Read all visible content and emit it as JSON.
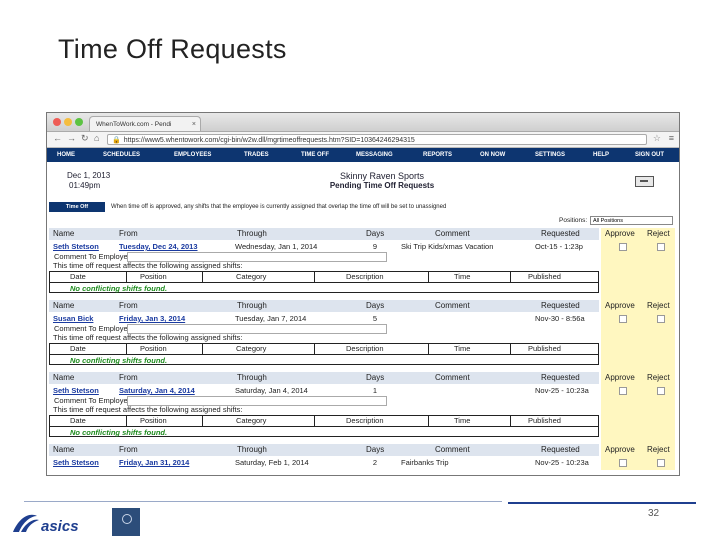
{
  "slide": {
    "title": "Time Off Requests",
    "page_number": "32"
  },
  "browser": {
    "tab_title": "WhenToWork.com - Pendi",
    "url": "https://www5.whentowork.com/cgi-bin/w2w.dll/mgrtimeoffrequests.htm?SID=10364246294315"
  },
  "nav": [
    "HOME",
    "SCHEDULES",
    "EMPLOYEES",
    "TRADES",
    "TIME OFF",
    "MESSAGING",
    "REPORTS",
    "ON NOW",
    "SETTINGS",
    "HELP",
    "SIGN OUT"
  ],
  "header": {
    "date": "Dec 1, 2013",
    "time": "01:49pm",
    "company": "Skinny Raven Sports",
    "page_heading": "Pending Time Off Requests"
  },
  "section_label": "Time Off",
  "notice": "When time off is approved, any shifts that the employee is currently assigned that overlap the time off will be set to unassigned",
  "positions": {
    "label": "Positions:",
    "selected": "All Positions"
  },
  "columns": [
    "Name",
    "From",
    "Through",
    "Days",
    "Comment",
    "Requested",
    "Approve",
    "Reject"
  ],
  "labels": {
    "comment_to_employee": "Comment To Employee:",
    "affects": "This time off request affects the following assigned shifts:",
    "no_conflicts": "No conflicting shifts found."
  },
  "shift_columns": [
    "Date",
    "Position",
    "Category",
    "Description",
    "Time",
    "Published"
  ],
  "requests": [
    {
      "name": "Seth Stetson",
      "from": "Tuesday, Dec 24, 2013",
      "through": "Wednesday, Jan 1, 2014",
      "days": "9",
      "comment": "Ski Trip Kids/xmas Vacation",
      "requested": "Oct-15 - 1:23p"
    },
    {
      "name": "Susan Bick",
      "from": "Friday, Jan 3, 2014",
      "through": "Tuesday, Jan 7, 2014",
      "days": "5",
      "comment": "",
      "requested": "Nov-30 - 8:56a"
    },
    {
      "name": "Seth Stetson",
      "from": "Saturday, Jan 4, 2014",
      "through": "Saturday, Jan 4, 2014",
      "days": "1",
      "comment": "",
      "requested": "Nov-25 - 10:23a"
    },
    {
      "name": "Seth Stetson",
      "from": "Friday, Jan 31, 2014",
      "through": "Saturday, Feb 1, 2014",
      "days": "2",
      "comment": "Fairbanks Trip",
      "requested": "Nov-25 - 10:23a"
    }
  ],
  "logos": {
    "asics": "asics"
  },
  "colors": {
    "nav_bg": "#0d3570",
    "no_conflict": "#1c8a1c",
    "approve_bg": "#fff7c0",
    "link": "#1a3aa0"
  }
}
